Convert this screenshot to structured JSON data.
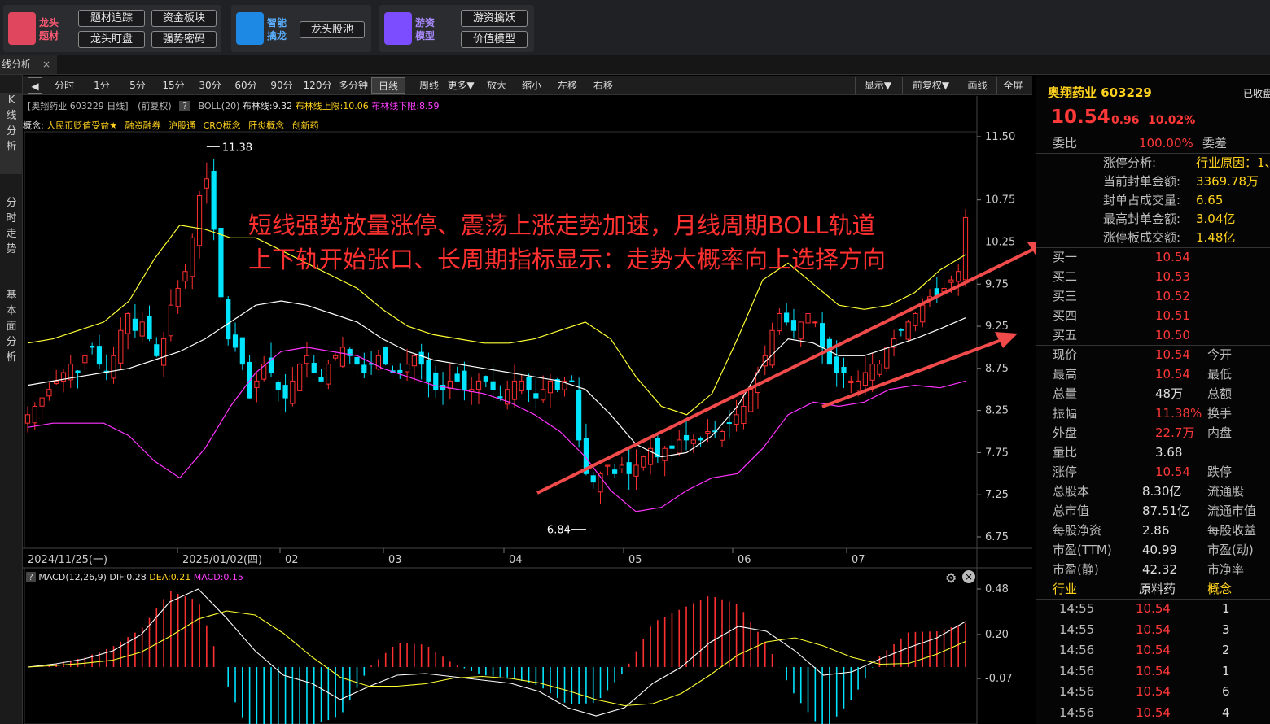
{
  "topbar": {
    "groups": [
      {
        "name": "龙头\n题材",
        "buttons": [
          "题材追踪",
          "资金板块",
          "龙头盯盘",
          "强势密码"
        ]
      },
      {
        "name": "智能\n擒龙",
        "buttons": [
          "龙头股池"
        ]
      },
      {
        "name": "游资\n模型",
        "buttons": [
          "游资擒妖",
          "价值模型"
        ]
      }
    ]
  },
  "tab": {
    "label": "线分析",
    "close": "×"
  },
  "side": {
    "items": [
      "K\n线\n分\n析",
      "分\n时\n走\n势",
      "基\n本\n面\n分\n析"
    ]
  },
  "toolbar": {
    "periods": [
      "分时",
      "1分",
      "5分",
      "15分",
      "30分",
      "60分",
      "90分",
      "120分",
      "多分钟",
      "日线",
      "周线",
      "更多▼",
      "放大",
      "缩小",
      "左移",
      "右移"
    ],
    "right": [
      "显示▼",
      "前复权▼",
      "画线",
      "全屏"
    ],
    "selected": "日线"
  },
  "info": {
    "line1": {
      "stock": "[奥翔药业 603229 日线]",
      "adj": "(前复权)",
      "q": "?",
      "boll": "BOLL(20)",
      "mid": "布林线:9.32",
      "up": "布林线上限:10.06",
      "low": "布林线下限:8.59"
    },
    "line2": {
      "label": "概念:",
      "tags": [
        "人民币贬值受益★",
        "融资融券",
        "沪股通",
        "CRO概念",
        "肝炎概念",
        "创新药"
      ]
    }
  },
  "annotation": [
    "短线强势放量涨停、震荡上涨走势加速，月线周期BOLL轨道",
    "上下轨开始张口、长周期指标显示：走势大概率向上选择方向"
  ],
  "dates": [
    "2024/11/25(一)",
    "2025/01/02(四)",
    "02",
    "03",
    "04",
    "05",
    "06",
    "07"
  ],
  "macd": {
    "label": "MACD(12,26,9)",
    "dif": "DIF:0.28",
    "dea": "DEA:0.21",
    "macd": "MACD:0.15"
  },
  "price_axis": [
    "11.50",
    "10.75",
    "10.25",
    "9.75",
    "9.25",
    "8.75",
    "8.25",
    "7.75",
    "7.25",
    "6.75"
  ],
  "macd_axis": [
    "0.48",
    "0.20",
    "-0.07"
  ],
  "markers": {
    "high": "11.38",
    "low": "6.84"
  },
  "colors": {
    "up": "#ff3030",
    "down": "#00e5ff",
    "boll_mid": "#ffffff",
    "boll_up": "#ffff33",
    "boll_low": "#ff33ff",
    "dif": "#ffffff",
    "dea": "#ffff33"
  },
  "quote": {
    "name": "奥翔药业 603229",
    "status": "已收盘",
    "price": "10.54",
    "chg": "0.96",
    "pct": "10.02%",
    "wb_label": "委比",
    "wb": "100.00%",
    "wc_label": "委差",
    "zt": [
      [
        "涨停分析:",
        "行业原因：1、..."
      ],
      [
        "当前封单金额:",
        "3369.78万"
      ],
      [
        "封单占成交量:",
        "6.65"
      ],
      [
        "最高封单金额:",
        "3.04亿"
      ],
      [
        "涨停板成交额:",
        "1.48亿"
      ]
    ],
    "buys": [
      [
        "买一",
        "10.54"
      ],
      [
        "买二",
        "10.53"
      ],
      [
        "买三",
        "10.52"
      ],
      [
        "买四",
        "10.51"
      ],
      [
        "买五",
        "10.50"
      ]
    ],
    "stats": [
      [
        "现价",
        "10.54",
        "今开",
        ""
      ],
      [
        "最高",
        "10.54",
        "最低",
        ""
      ],
      [
        "总量",
        "48万",
        "总额",
        ""
      ],
      [
        "振幅",
        "11.38%",
        "换手",
        ""
      ],
      [
        "外盘",
        "22.7万",
        "内盘",
        ""
      ],
      [
        "量比",
        "3.68",
        "",
        ""
      ],
      [
        "涨停",
        "10.54",
        "跌停",
        ""
      ]
    ],
    "fund": [
      [
        "总股本",
        "8.30亿",
        "流通股"
      ],
      [
        "总市值",
        "87.51亿",
        "流通市值"
      ],
      [
        "每股净资",
        "2.86",
        "每股收益"
      ],
      [
        "市盈(TTM)",
        "40.99",
        "市盈(动)"
      ],
      [
        "市盈(静)",
        "42.32",
        "市净率"
      ]
    ],
    "ind": [
      "行业",
      "原料药",
      "概念"
    ],
    "ticks": [
      [
        "14:55",
        "10.54",
        "1"
      ],
      [
        "14:55",
        "10.54",
        "3"
      ],
      [
        "14:56",
        "10.54",
        "2"
      ],
      [
        "14:56",
        "10.54",
        "1"
      ],
      [
        "14:56",
        "10.54",
        "6"
      ],
      [
        "14:56",
        "10.54",
        "4"
      ]
    ]
  },
  "chart_data": {
    "type": "candlestick",
    "title": "奥翔药业 603229 日线",
    "x_start": "2024/11/25",
    "x_end": "2025/07",
    "ylim": [
      6.75,
      11.5
    ],
    "high_marker": 11.38,
    "low_marker": 6.84,
    "last_close": 10.54,
    "closes": [
      8.2,
      8.3,
      8.4,
      8.5,
      8.6,
      8.7,
      8.8,
      8.7,
      8.9,
      9.0,
      8.8,
      8.7,
      8.9,
      9.2,
      9.4,
      9.2,
      9.3,
      9.1,
      8.9,
      9.1,
      9.5,
      9.7,
      9.9,
      10.3,
      10.8,
      11.0,
      10.4,
      9.6,
      9.1,
      9.0,
      8.8,
      8.4,
      8.6,
      8.8,
      8.7,
      8.5,
      8.4,
      8.6,
      8.8,
      8.9,
      8.7,
      8.6,
      8.8,
      8.9,
      9.0,
      8.9,
      8.8,
      8.7,
      8.8,
      8.9,
      8.8,
      8.7,
      8.7,
      8.8,
      8.9,
      8.8,
      8.6,
      8.5,
      8.5,
      8.6,
      8.6,
      8.5,
      8.5,
      8.6,
      8.6,
      8.5,
      8.4,
      8.5,
      8.6,
      8.6,
      8.5,
      8.4,
      8.5,
      8.6,
      8.5,
      8.6,
      8.6,
      7.9,
      7.5,
      7.4,
      7.5,
      7.6,
      7.5,
      7.6,
      7.5,
      7.6,
      7.7,
      7.8,
      7.7,
      7.8,
      7.8,
      7.9,
      7.9,
      7.9,
      7.9,
      8.0,
      8.0,
      8.0,
      8.1,
      8.2,
      8.3,
      8.5,
      8.7,
      8.9,
      9.2,
      9.4,
      9.3,
      9.2,
      9.3,
      9.4,
      9.3,
      9.0,
      8.8,
      8.7,
      8.7,
      8.6,
      8.6,
      8.7,
      8.8,
      8.8,
      9.0,
      9.1,
      9.2,
      9.3,
      9.4,
      9.5,
      9.6,
      9.6,
      9.7,
      9.8,
      9.9,
      10.54
    ],
    "boll_mid": [
      8.55,
      8.6,
      8.65,
      8.7,
      8.75,
      8.85,
      8.95,
      9.1,
      9.3,
      9.5,
      9.55,
      9.5,
      9.4,
      9.3,
      9.1,
      8.95,
      8.85,
      8.8,
      8.75,
      8.7,
      8.65,
      8.6,
      8.5,
      8.2,
      7.85,
      7.7,
      7.75,
      7.95,
      8.3,
      8.8,
      9.1,
      9.05,
      8.9,
      8.9,
      9.0,
      9.1,
      9.22,
      9.35
    ],
    "macd_dif": [
      0.0,
      0.02,
      0.05,
      0.1,
      0.2,
      0.4,
      0.48,
      0.3,
      0.1,
      -0.05,
      -0.1,
      -0.2,
      -0.12,
      -0.05,
      -0.04,
      -0.06,
      -0.08,
      -0.1,
      -0.15,
      -0.25,
      -0.3,
      -0.25,
      -0.1,
      0.0,
      0.15,
      0.25,
      0.22,
      0.1,
      -0.05,
      -0.03,
      0.05,
      0.12,
      0.18,
      0.28
    ]
  }
}
